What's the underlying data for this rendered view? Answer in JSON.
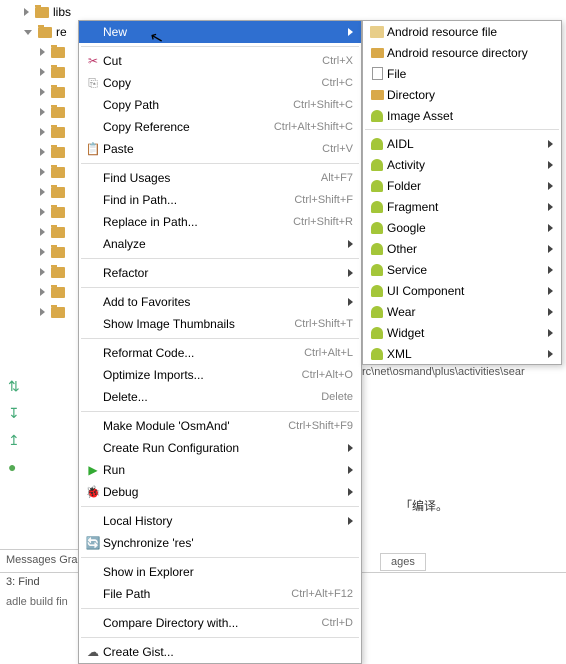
{
  "tree": {
    "root_label": "re",
    "libs_label": "libs"
  },
  "messages_label": "Messages Gradle",
  "bottom_find": "3: Find",
  "bottom_status": "adle build fin",
  "breadcrumb": "rc\\net\\osmand\\plus\\activities\\sear",
  "cn_text_suffix": "「编译。",
  "tab_label": "ages",
  "menu": {
    "new": "New",
    "cut": "Cut",
    "cut_sc": "Ctrl+X",
    "copy": "Copy",
    "copy_sc": "Ctrl+C",
    "copy_path": "Copy Path",
    "copy_path_sc": "Ctrl+Shift+C",
    "copy_ref": "Copy Reference",
    "copy_ref_sc": "Ctrl+Alt+Shift+C",
    "paste": "Paste",
    "paste_sc": "Ctrl+V",
    "find_usages": "Find Usages",
    "find_usages_sc": "Alt+F7",
    "find_path": "Find in Path...",
    "find_path_sc": "Ctrl+Shift+F",
    "replace_path": "Replace in Path...",
    "replace_path_sc": "Ctrl+Shift+R",
    "analyze": "Analyze",
    "refactor": "Refactor",
    "add_fav": "Add to Favorites",
    "thumbnails": "Show Image Thumbnails",
    "thumbnails_sc": "Ctrl+Shift+T",
    "reformat": "Reformat Code...",
    "reformat_sc": "Ctrl+Alt+L",
    "optimize": "Optimize Imports...",
    "optimize_sc": "Ctrl+Alt+O",
    "delete": "Delete...",
    "delete_sc": "Delete",
    "make": "Make Module 'OsmAnd'",
    "make_sc": "Ctrl+Shift+F9",
    "create_run": "Create Run Configuration",
    "run": "Run",
    "debug": "Debug",
    "local_history": "Local History",
    "synchronize": "Synchronize 'res'",
    "explorer": "Show in Explorer",
    "file_path": "File Path",
    "file_path_sc": "Ctrl+Alt+F12",
    "compare": "Compare Directory with...",
    "compare_sc": "Ctrl+D",
    "gist": "Create Gist..."
  },
  "submenu": {
    "res_file": "Android resource file",
    "res_dir": "Android resource directory",
    "file": "File",
    "directory": "Directory",
    "image_asset": "Image Asset",
    "aidl": "AIDL",
    "activity": "Activity",
    "folder": "Folder",
    "fragment": "Fragment",
    "google": "Google",
    "other": "Other",
    "service": "Service",
    "ui_component": "UI Component",
    "wear": "Wear",
    "widget": "Widget",
    "xml": "XML"
  }
}
